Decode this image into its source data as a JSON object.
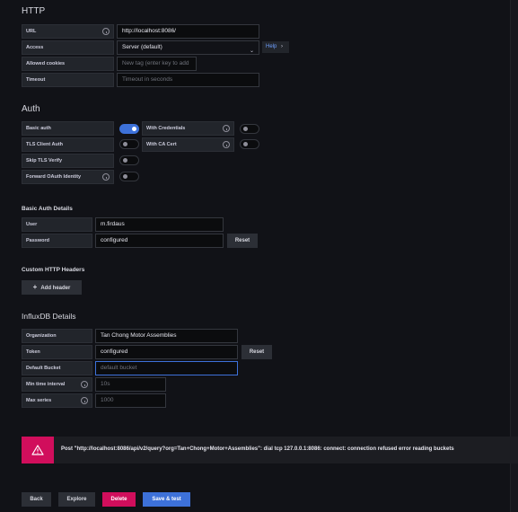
{
  "http": {
    "title": "HTTP",
    "url": {
      "label": "URL",
      "value": "http://localhost:8086/"
    },
    "access": {
      "label": "Access",
      "value": "Server (default)",
      "help": "Help"
    },
    "allowed_cookies": {
      "label": "Allowed cookies",
      "placeholder": "New tag (enter key to add"
    },
    "timeout": {
      "label": "Timeout",
      "placeholder": "Timeout in seconds"
    }
  },
  "auth": {
    "title": "Auth",
    "basic_auth": {
      "label": "Basic auth",
      "on": true
    },
    "with_credentials": {
      "label": "With Credentials",
      "on": false
    },
    "tls_client_auth": {
      "label": "TLS Client Auth",
      "on": false
    },
    "with_ca_cert": {
      "label": "With CA Cert",
      "on": false
    },
    "skip_tls_verify": {
      "label": "Skip TLS Verify",
      "on": false
    },
    "forward_oauth": {
      "label": "Forward OAuth Identity",
      "on": false
    }
  },
  "basic_auth_details": {
    "title": "Basic Auth Details",
    "user": {
      "label": "User",
      "value": "m.firdaus"
    },
    "password": {
      "label": "Password",
      "value": "configured",
      "reset": "Reset"
    }
  },
  "custom_headers": {
    "title": "Custom HTTP Headers",
    "add_label": "Add header"
  },
  "influx": {
    "title": "InfluxDB Details",
    "organization": {
      "label": "Organization",
      "value": "Tan Chong Motor Assemblies"
    },
    "token": {
      "label": "Token",
      "value": "configured",
      "reset": "Reset"
    },
    "default_bucket": {
      "label": "Default Bucket",
      "placeholder": "default bucket"
    },
    "min_time_interval": {
      "label": "Min time interval",
      "placeholder": "10s"
    },
    "max_series": {
      "label": "Max series",
      "placeholder": "1000"
    }
  },
  "error": {
    "message": "Post \"http://localhost:8086/api/v2/query?org=Tan+Chong+Motor+Assemblies\": dial tcp 127.0.0.1:8086: connect: connection refused error reading buckets"
  },
  "footer": {
    "back": "Back",
    "explore": "Explore",
    "delete": "Delete",
    "save_test": "Save & test"
  },
  "colors": {
    "background": "#111217",
    "primary": "#3d71d9",
    "danger": "#d10e5c"
  }
}
